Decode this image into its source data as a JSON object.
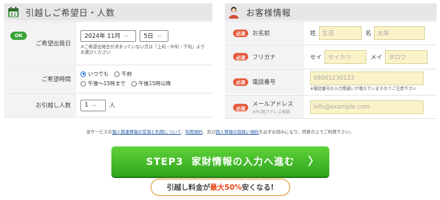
{
  "left_panel": {
    "title": "引越しご希望日・人数",
    "ok_badge": "OK",
    "date": {
      "label": "ご希望出発日",
      "month_value": "2024年 11月",
      "day_value": "5日",
      "note": "※ご希望出発日が決まっていない方は「上旬・中旬・下旬」よりお選びください"
    },
    "time": {
      "label": "ご希望時間",
      "options": [
        "いつでも",
        "午前",
        "午後〜15時まで",
        "午後15時以降"
      ],
      "selected": "いつでも"
    },
    "people": {
      "label": "お引越し人数",
      "value": "1",
      "unit": "人"
    }
  },
  "right_panel": {
    "title": "お客様情報",
    "required_badge": "必須",
    "name": {
      "label": "お名前",
      "last_label": "姓",
      "last_placeholder": "生活",
      "first_label": "名",
      "first_placeholder": "太郎"
    },
    "kana": {
      "label": "フリガナ",
      "last_label": "セイ",
      "last_placeholder": "セイカツ",
      "first_label": "メイ",
      "first_placeholder": "タロウ"
    },
    "phone": {
      "label": "電話番号",
      "placeholder": "09001230123",
      "note": "※電話番号の入力間違いが増えていますのでご注意下さい"
    },
    "email": {
      "label": "メールアドレス",
      "sublabel": "※PC用アドレス推奨",
      "placeholder": "info@example.com"
    }
  },
  "consent": {
    "prefix": "当サービスの",
    "link1": "個人関連情報の受領と利用について",
    "sep1": "、",
    "link2": "利用規約",
    "sep2": "、及び",
    "link3": "個人情報の取扱い規約",
    "suffix": "を必ずお読みになり、同意の上でご利用下さい。"
  },
  "cta": {
    "label": "STEP3  家財情報の入力へ進む",
    "arrow": "〉"
  },
  "promo": {
    "pre": "引越し料金が",
    "highlight": "最大50%",
    "post": "安くなる!"
  },
  "colors": {
    "cta_green": "#3cb72a",
    "required_red": "#e85b3e",
    "ok_green": "#3aa43a",
    "input_yellow": "#fbf3c8",
    "promo_orange": "#e0891c"
  },
  "icons": {
    "calendar": "calendar-icon",
    "person": "person-icon",
    "arrow": "chevron-right-icon"
  }
}
